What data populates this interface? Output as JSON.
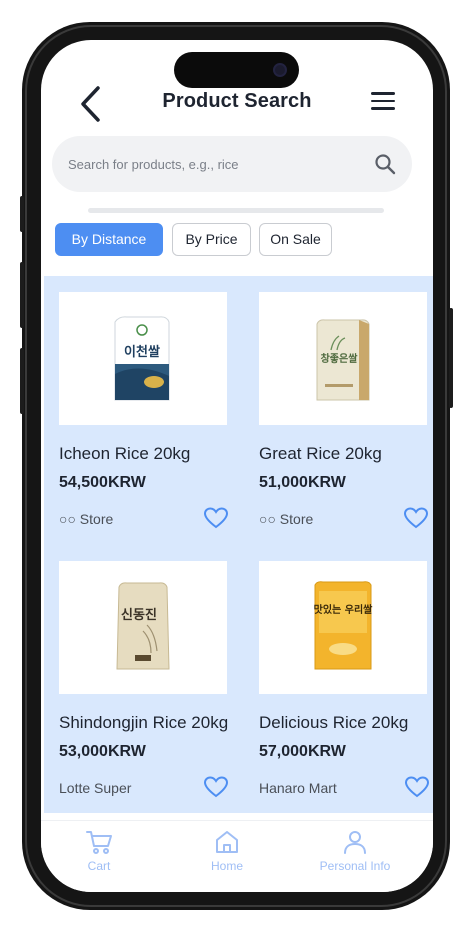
{
  "header": {
    "title": "Product Search"
  },
  "search": {
    "placeholder": "Search for products, e.g., rice",
    "value": ""
  },
  "filters": [
    {
      "label": "By Distance",
      "active": true
    },
    {
      "label": "By Price",
      "active": false
    },
    {
      "label": "On Sale",
      "active": false
    }
  ],
  "products": [
    {
      "name": "Icheon Rice 20kg",
      "price": "54,500KRW",
      "store": "○○ Store",
      "bag_text": "이천쌀",
      "bag_color": "#2d5a7e"
    },
    {
      "name": "Great  Rice 20kg",
      "price": "51,000KRW",
      "store": "○○ Store",
      "bag_text": "창좋은쌀",
      "bag_color": "#e9e4cf"
    },
    {
      "name": "Shindongjin Rice 20kg",
      "price": "53,000KRW",
      "store": "Lotte Super",
      "bag_text": "신동진",
      "bag_color": "#e6dcc0"
    },
    {
      "name": "Delicious Rice 20kg",
      "price": "57,000KRW",
      "store": "Hanaro Mart",
      "bag_text": "맛있는 우리쌀",
      "bag_color": "#f3b42c"
    }
  ],
  "bottom_nav": [
    {
      "label": "Cart",
      "icon": "cart-icon"
    },
    {
      "label": "Home",
      "icon": "home-icon"
    },
    {
      "label": "Personal Info",
      "icon": "person-icon"
    }
  ],
  "colors": {
    "accent": "#4d8ef2",
    "grid_background": "#d9e8fd",
    "heart": "#4d8ef2",
    "nav_label": "#9fbef5"
  }
}
